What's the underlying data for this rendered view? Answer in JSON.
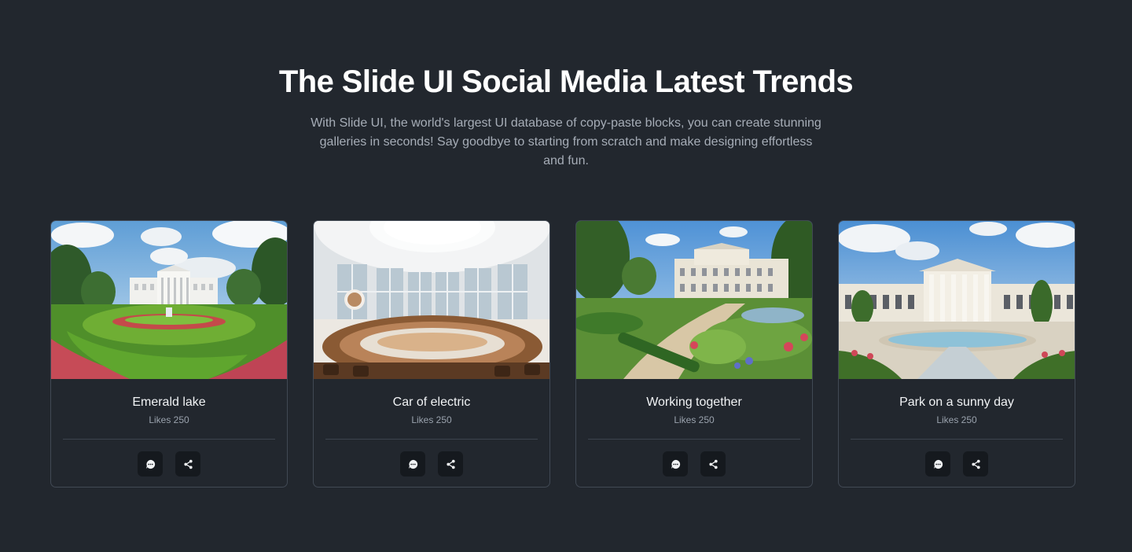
{
  "header": {
    "title": "The Slide UI Social Media Latest Trends",
    "subtitle": "With Slide UI, the world's largest UI database of copy-paste blocks, you can create stunning galleries in seconds! Say goodbye to starting from scratch and make designing effortless and fun."
  },
  "cards": [
    {
      "title": "Emerald lake",
      "likes": "Likes 250",
      "image": "white-house-garden-photo"
    },
    {
      "title": "Car of electric",
      "likes": "Likes 250",
      "image": "round-assembly-hall-photo"
    },
    {
      "title": "Working together",
      "likes": "Likes 250",
      "image": "palace-garden-path-photo"
    },
    {
      "title": "Park on a sunny day",
      "likes": "Likes 250",
      "image": "mansion-fountain-pool-photo"
    }
  ],
  "icons": {
    "comment": "comment-icon",
    "share": "share-icon"
  },
  "colors": {
    "background": "#22272e",
    "card_border": "#414954",
    "button_bg": "#15191e",
    "title": "#ffffff",
    "muted_text": "#a6adb7"
  }
}
